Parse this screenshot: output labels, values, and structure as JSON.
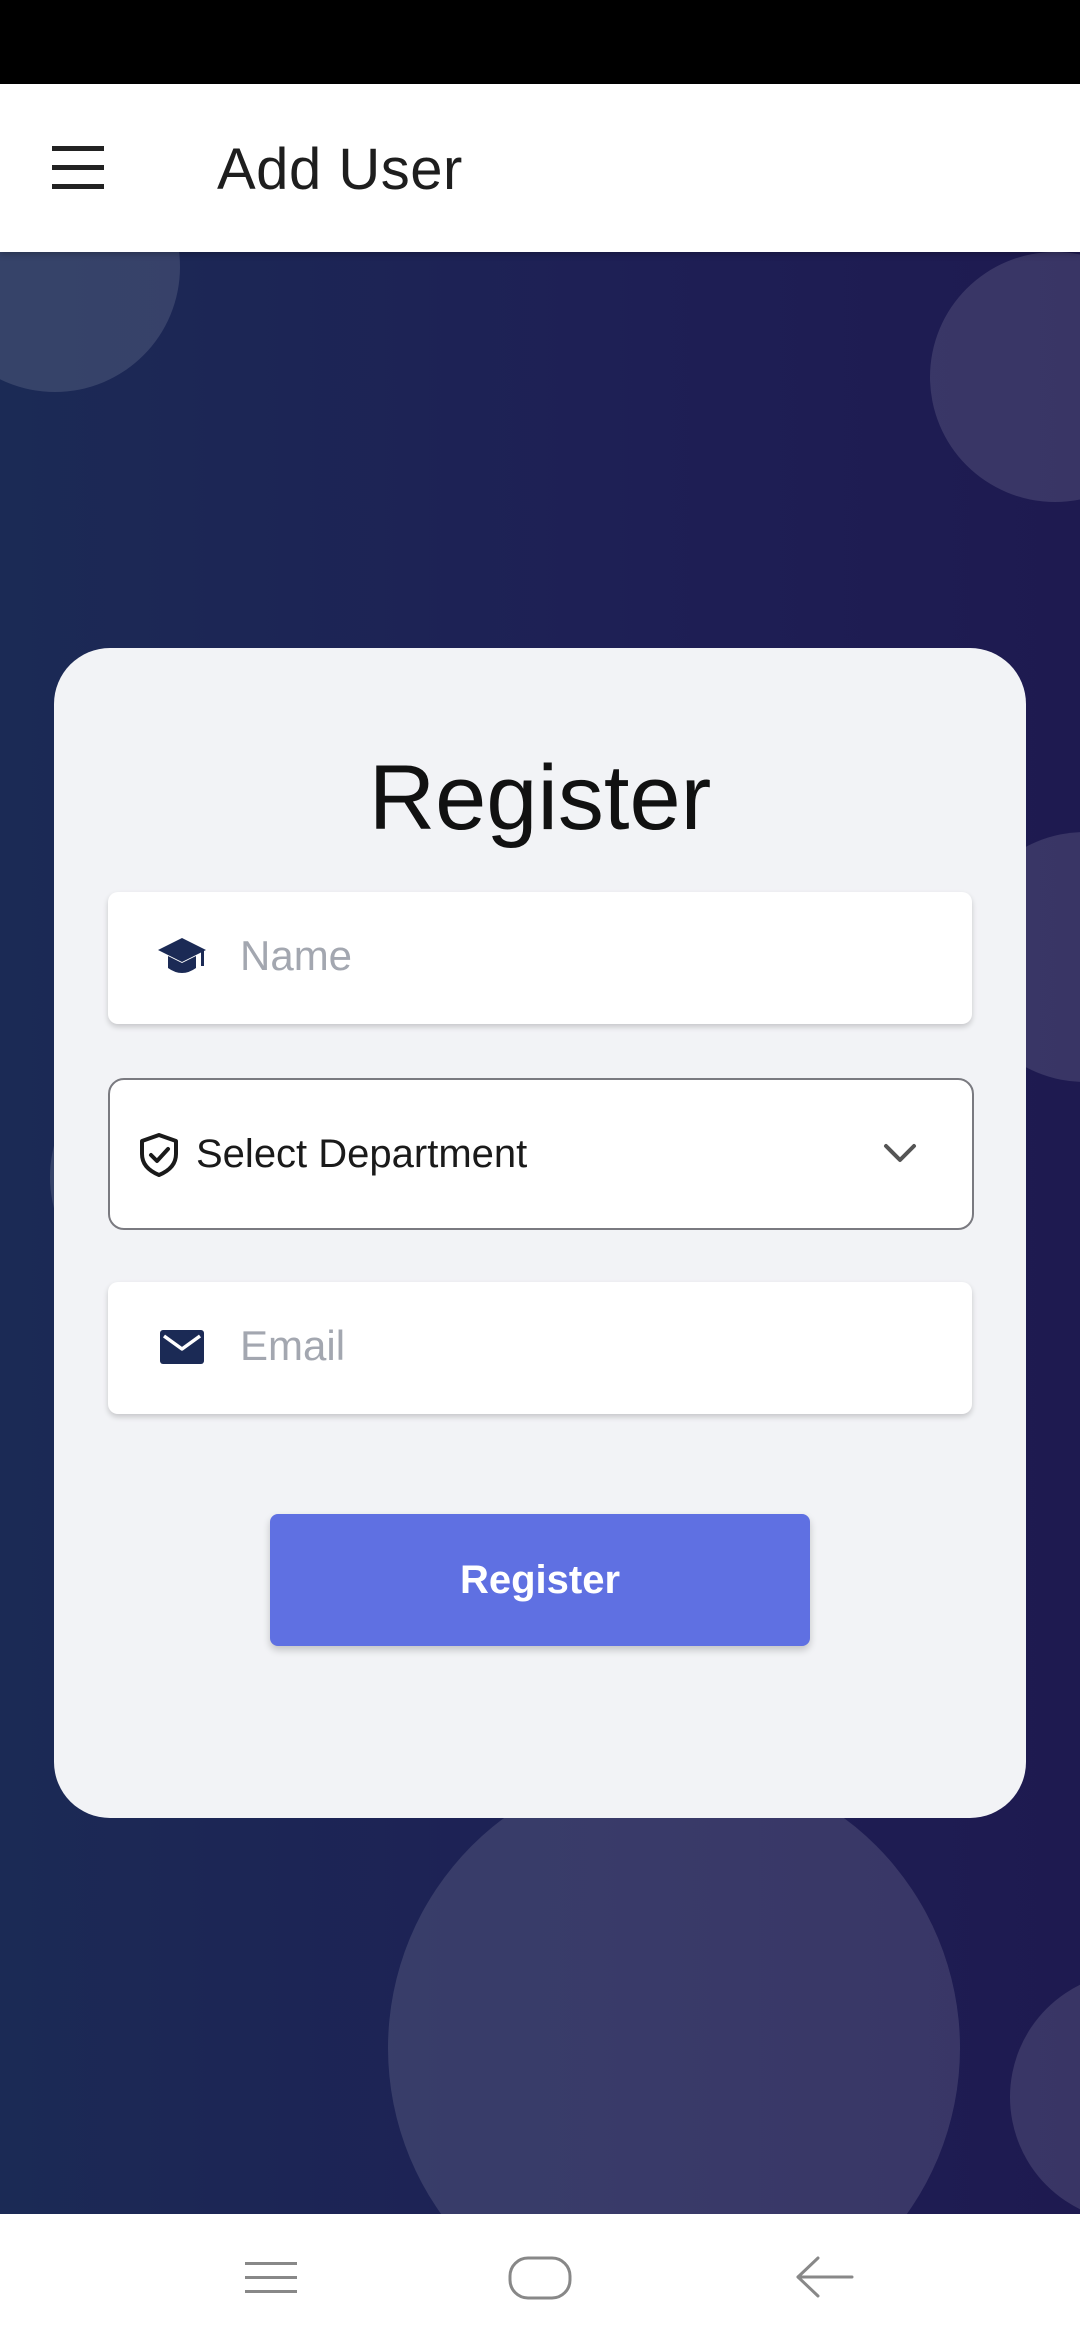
{
  "app_bar": {
    "menu_icon": "menu-icon",
    "title": "Add User"
  },
  "form": {
    "title": "Register",
    "name_field": {
      "icon": "graduation-cap-icon",
      "placeholder": "Name",
      "value": ""
    },
    "department_select": {
      "icon": "shield-check-icon",
      "selected": "Select Department",
      "chevron": "chevron-down-icon"
    },
    "email_field": {
      "icon": "envelope-icon",
      "placeholder": "Email",
      "value": ""
    },
    "submit_label": "Register"
  },
  "nav_bar": {
    "recent_icon": "recent-apps-icon",
    "home_icon": "home-icon",
    "back_icon": "back-arrow-icon"
  },
  "colors": {
    "background": "#1c2452",
    "card": "#f2f3f6",
    "button": "#5f70e2",
    "icon": "#1b2a55",
    "placeholder": "#a3a7b0"
  }
}
